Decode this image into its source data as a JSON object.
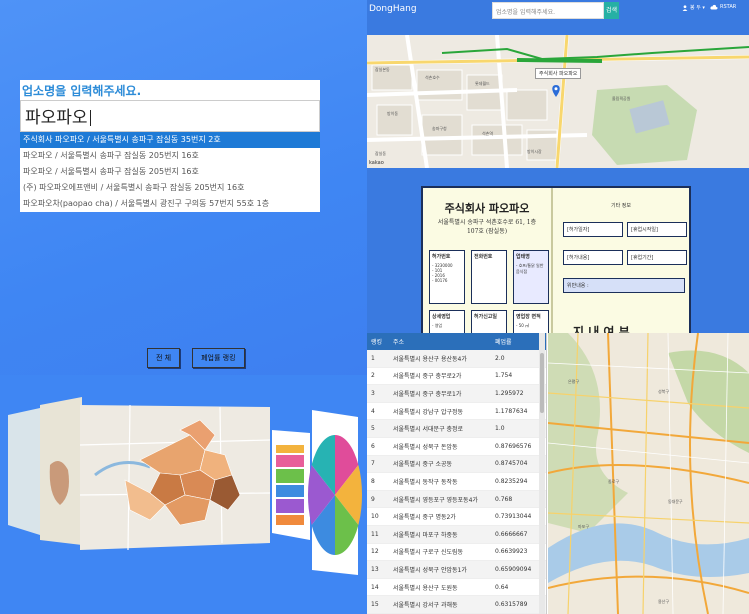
{
  "search_panel": {
    "heading": "업소명을 입력해주세요.",
    "query": "파오파오",
    "suggestions": [
      "주식회사 파오파오 / 서울특별시 송파구 잠실동 35번지 2호",
      "파오파오 / 서울특별시 송파구 잠실동 205번지 16호",
      "파오파오 / 서울특별시 송파구 잠실동 205번지 16호",
      "(주) 파오파오에프앤비 / 서울특별시 송파구 잠실동 205번지 16호",
      "파오파오차(paopao cha) / 서울특별시 광진구 구의동 57번지 55호 1층"
    ],
    "buttons": {
      "all": "전 체",
      "closure_rate": "폐업률 랭킹"
    }
  },
  "navbar": {
    "brand": "DongHang",
    "search_placeholder": "업소명을 입력해주세요.",
    "search_button": "검색",
    "menu": "봉 두 ▾",
    "login": "RSTAR"
  },
  "top_map": {
    "tooltip": "주식회사 파오파오",
    "credit": "kakao"
  },
  "company_card": {
    "title": "주식회사 파오파오",
    "address_line1": "서울특별시 송파구 석촌호수로 61, 1층",
    "address_line2": "107호 (잠실동)",
    "permit_title": "허가번호",
    "permit_lines": [
      "- 3230000",
      "- 101",
      "- 2016",
      "- 00176"
    ],
    "phone_title": "전화번호",
    "industry_title": "업태명",
    "industry_value": "- 호프/통닭 일반 음식점",
    "status_title": "상세영업",
    "status_value": "- 영업",
    "stage_title": "허가신고일",
    "area_title": "영업장 면적",
    "area_value": "- 50 ㎡",
    "other_title": "기타 정보",
    "fields": [
      "[허가일자]",
      "[휴업시작일]",
      "[허가내용]",
      "[휴업기간]"
    ],
    "violation": "위반내용 :",
    "cut_text": "지 내 여 부"
  },
  "ranking_table": {
    "headers": [
      "랭킹",
      "주소",
      "폐업률"
    ],
    "rows": [
      [
        "1",
        "서울특별시 용산구 용산동4가",
        "2.0"
      ],
      [
        "2",
        "서울특별시 중구 충무로2가",
        "1.754"
      ],
      [
        "3",
        "서울특별시 중구 충무로1가",
        "1.295972"
      ],
      [
        "4",
        "서울특별시 강남구 압구정동",
        "1.1787634"
      ],
      [
        "5",
        "서울특별시 서대문구 충정로",
        "1.0"
      ],
      [
        "6",
        "서울특별시 성북구 돈암동",
        "0.87696576"
      ],
      [
        "7",
        "서울특별시 중구 소공동",
        "0.8745704"
      ],
      [
        "8",
        "서울특별시 동작구 동작동",
        "0.8235294"
      ],
      [
        "9",
        "서울특별시 영등포구 영등포동4가",
        "0.768"
      ],
      [
        "10",
        "서울특별시 중구 명동2가",
        "0.73913044"
      ],
      [
        "11",
        "서울특별시 마포구 하중동",
        "0.6666667"
      ],
      [
        "12",
        "서울특별시 구로구 신도림동",
        "0.6639923"
      ],
      [
        "13",
        "서울특별시 성북구 안암동1가",
        "0.65909094"
      ],
      [
        "14",
        "서울특별시 용산구 도원동",
        "0.64"
      ],
      [
        "15",
        "서울특별시 강서구 과해동",
        "0.6315789"
      ]
    ]
  },
  "colors": {
    "page_blue": "#4a8bf5",
    "nav_blue": "#3a7ae0",
    "suggest_active": "#1e7ad6",
    "table_header": "#2b6fba",
    "search_button": "#26b0a4",
    "card_bg": "#fbfbe3",
    "route_green": "#2aa63a"
  },
  "icons": [
    "map-pin-icon",
    "cloud-icon",
    "person-icon",
    "caret-down-icon"
  ]
}
